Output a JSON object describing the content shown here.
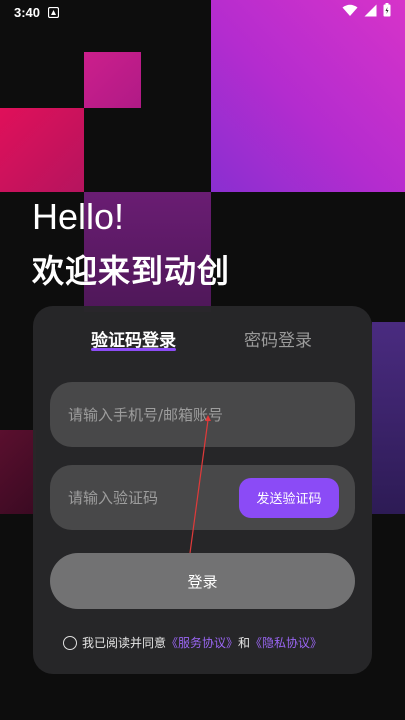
{
  "status_bar": {
    "time": "3:40"
  },
  "greeting": {
    "hello": "Hello!",
    "welcome": "欢迎来到动创"
  },
  "tabs": [
    {
      "label": "验证码登录",
      "active": true
    },
    {
      "label": "密码登录",
      "active": false
    }
  ],
  "form": {
    "account_placeholder": "请输入手机号/邮箱账号",
    "code_placeholder": "请输入验证码",
    "send_code_label": "发送验证码",
    "login_label": "登录"
  },
  "agreement": {
    "prefix": "我已阅读并同意",
    "service_link": "《服务协议》",
    "and": "和",
    "privacy_link": "《隐私协议》"
  },
  "colors": {
    "accent": "#8b4bf6",
    "card": "#28282a",
    "field": "#484849",
    "login_button": "#727273"
  },
  "icons": [
    "notification-icon",
    "wifi-icon",
    "signal-icon",
    "battery-icon",
    "radio-unchecked-icon"
  ]
}
